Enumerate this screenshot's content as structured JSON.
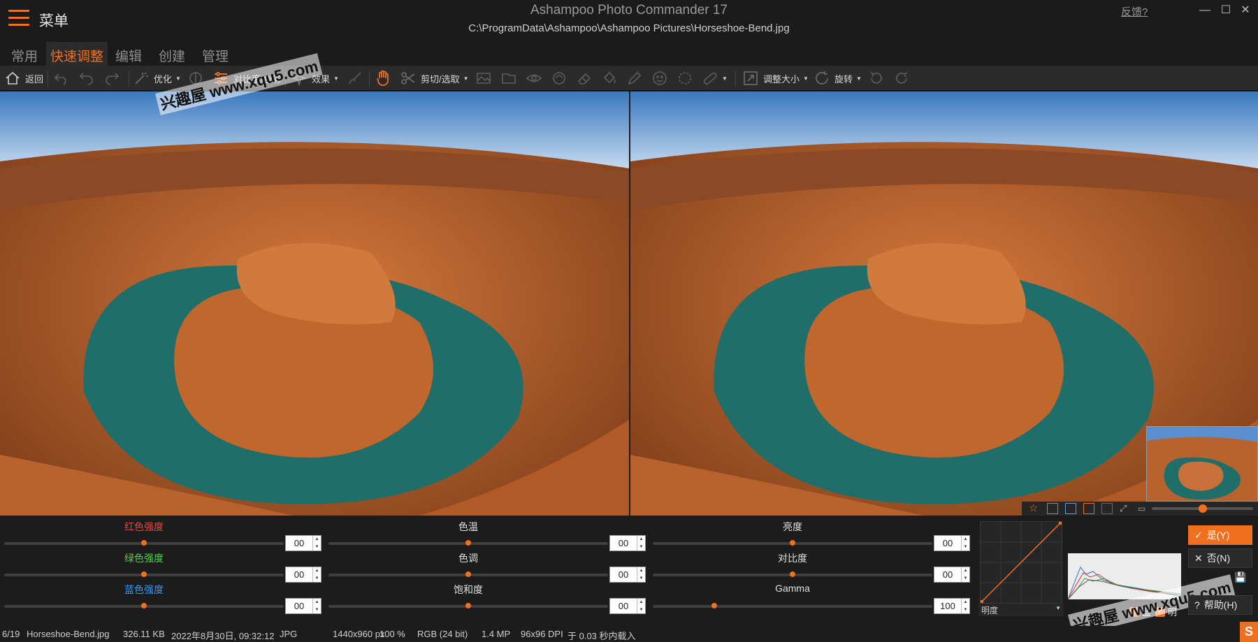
{
  "titlebar": {
    "menu_label": "菜单",
    "app_title": "Ashampoo Photo Commander 17",
    "file_path": "C:\\ProgramData\\Ashampoo\\Ashampoo Pictures\\Horseshoe-Bend.jpg",
    "feedback": "反馈?",
    "minimize": "—",
    "maximize": "☐",
    "close": "✕"
  },
  "tabs": [
    "常用",
    "快速调整",
    "编辑",
    "创建",
    "管理"
  ],
  "active_tab": "快速调整",
  "toolbar": {
    "back": "返回",
    "optimize": "优化",
    "contrast_color": "对比度/色彩",
    "effects": "效果",
    "crop_select": "剪切/选取",
    "resize": "调整大小",
    "rotate": "旋转"
  },
  "watermark_text": "兴趣屋 www.xqu5.com",
  "sliders": {
    "col1": [
      {
        "label": "红色强度",
        "value": "00",
        "level": 0.5,
        "color": "#ff3b3b"
      },
      {
        "label": "绿色强度",
        "value": "00",
        "level": 0.5,
        "color": "#4fd04f"
      },
      {
        "label": "蓝色强度",
        "value": "00",
        "level": 0.5,
        "color": "#2f9bff"
      }
    ],
    "col2": [
      {
        "label": "色温",
        "value": "00",
        "level": 0.5,
        "color": "#e0e0e0"
      },
      {
        "label": "色调",
        "value": "00",
        "level": 0.5,
        "color": "#e0e0e0"
      },
      {
        "label": "饱和度",
        "value": "00",
        "level": 0.5,
        "color": "#e0e0e0"
      }
    ],
    "col3": [
      {
        "label": "亮度",
        "value": "00",
        "level": 0.5,
        "color": "#e0e0e0"
      },
      {
        "label": "对比度",
        "value": "00",
        "level": 0.5,
        "color": "#e0e0e0"
      },
      {
        "label": "Gamma",
        "value": "100",
        "level": 0.22,
        "color": "#e0e0e0"
      }
    ]
  },
  "curve": {
    "channel": "明度"
  },
  "histogram": {
    "blue_label": "蓝",
    "lightness_label": "明"
  },
  "dialog": {
    "yes": "是(Y)",
    "no": "否(N)",
    "help": "帮助(H)"
  },
  "nav": {
    "zoom_level": 0.5
  },
  "status": {
    "index": "6/19",
    "filename": "Horseshoe-Bend.jpg",
    "size": "326.11 KB",
    "date": "2022年8月30日, 09:32:12",
    "format": "JPG",
    "dimensions": "1440x960 px",
    "zoom": "100 %",
    "color_mode": "RGB (24 bit)",
    "megapixels": "1.4 MP",
    "dpi": "96x96 DPI",
    "load_time": "于 0.03 秒内载入"
  },
  "accent_color": "#f07020"
}
